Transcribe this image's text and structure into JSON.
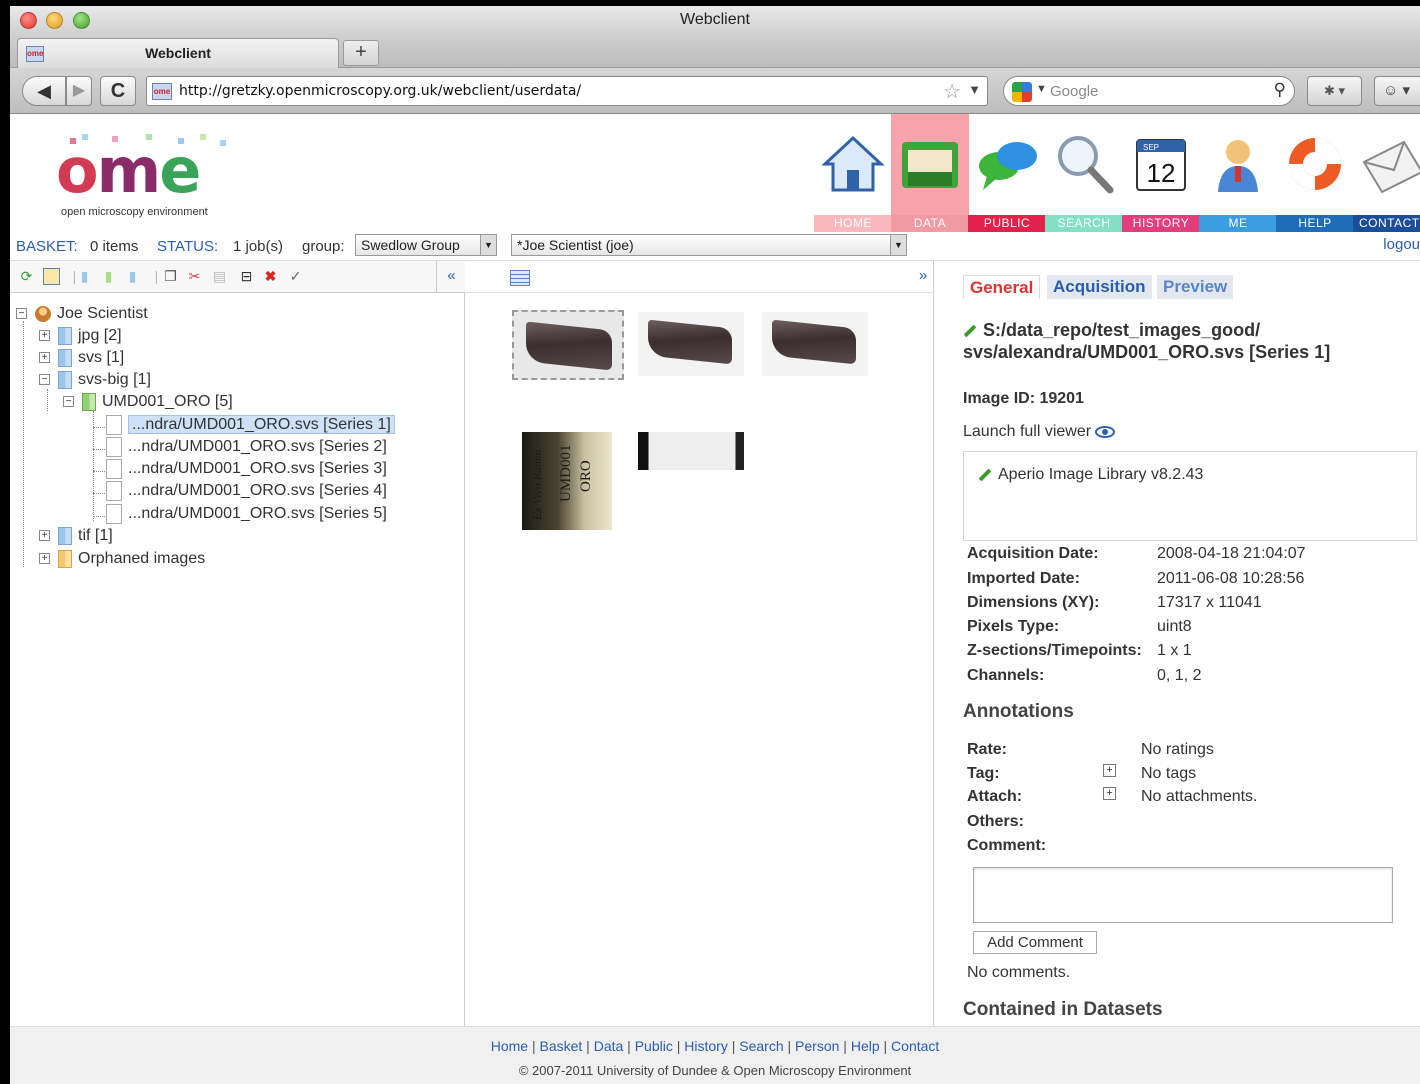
{
  "window": {
    "title": "Webclient"
  },
  "browser": {
    "tab_label": "Webclient",
    "new_tab": "+",
    "back": "◀",
    "forward": "▶",
    "reload": "C",
    "url": "http://gretzky.openmicroscopy.org.uk/webclient/userdata/",
    "search_placeholder": "Google"
  },
  "logo": {
    "word": "ome",
    "tagline": "open microscopy environment"
  },
  "nav": [
    {
      "label": "HOME"
    },
    {
      "label": "DATA"
    },
    {
      "label": "PUBLIC"
    },
    {
      "label": "SEARCH"
    },
    {
      "label": "HISTORY",
      "calendar_month": "SEP",
      "calendar_day": "12"
    },
    {
      "label": "ME"
    },
    {
      "label": "HELP"
    },
    {
      "label": "CONTACT"
    }
  ],
  "status": {
    "basket_label": "BASKET:",
    "basket_value": "0 items",
    "status_label": "STATUS:",
    "status_value": "1 job(s)",
    "group_label": "group:",
    "group_value": "Swedlow Group",
    "user_value": "*Joe Scientist (joe)",
    "logout": "logou"
  },
  "tree": {
    "collapse": "«",
    "root": "Joe Scientist",
    "projects": [
      {
        "label": "jpg [2]"
      },
      {
        "label": "svs [1]"
      },
      {
        "label": "svs-big [1]"
      }
    ],
    "dataset": "UMD001_ORO [5]",
    "images": [
      "...ndra/UMD001_ORO.svs [Series 1]",
      "...ndra/UMD001_ORO.svs [Series 2]",
      "...ndra/UMD001_ORO.svs [Series 3]",
      "...ndra/UMD001_ORO.svs [Series 4]",
      "...ndra/UMD001_ORO.svs [Series 5]"
    ],
    "tif": "tif [1]",
    "orphaned": "Orphaned images"
  },
  "center": {
    "expand": "»",
    "label_text_1": "Ex Vivo Ramm",
    "label_text_2": "UMD001",
    "label_text_3": "ORO"
  },
  "details": {
    "tabs": [
      "General",
      "Acquisition",
      "Preview"
    ],
    "path": "S:/data_repo/test_images_good/ svs/alexandra/UMD001_ORO.svs [Series 1]",
    "image_id": "Image ID: 19201",
    "launch_viewer": "Launch full viewer",
    "description": "Aperio Image Library v8.2.43",
    "fields": [
      {
        "key": "Acquisition Date:",
        "value": "2008-04-18 21:04:07"
      },
      {
        "key": "Imported Date:",
        "value": "2011-06-08 10:28:56"
      },
      {
        "key": "Dimensions (XY):",
        "value": "17317 x 11041"
      },
      {
        "key": "Pixels Type:",
        "value": "uint8"
      },
      {
        "key": "Z-sections/Timepoints:",
        "value": "1 x 1"
      },
      {
        "key": "Channels:",
        "value": "0, 1, 2"
      }
    ],
    "annotations_heading": "Annotations",
    "rate_label": "Rate:",
    "rate_value": "No ratings",
    "tag_label": "Tag:",
    "tag_value": "No tags",
    "attach_label": "Attach:",
    "attach_value": "No attachments.",
    "others_label": "Others:",
    "comment_label": "Comment:",
    "add_comment": "Add Comment",
    "no_comments": "No comments.",
    "contained_heading": "Contained in Datasets"
  },
  "footer": {
    "links": [
      "Home",
      "Basket",
      "Data",
      "Public",
      "History",
      "Search",
      "Person",
      "Help",
      "Contact"
    ],
    "copyright": "© 2007-2011 University of Dundee & Open Microscopy Environment"
  }
}
